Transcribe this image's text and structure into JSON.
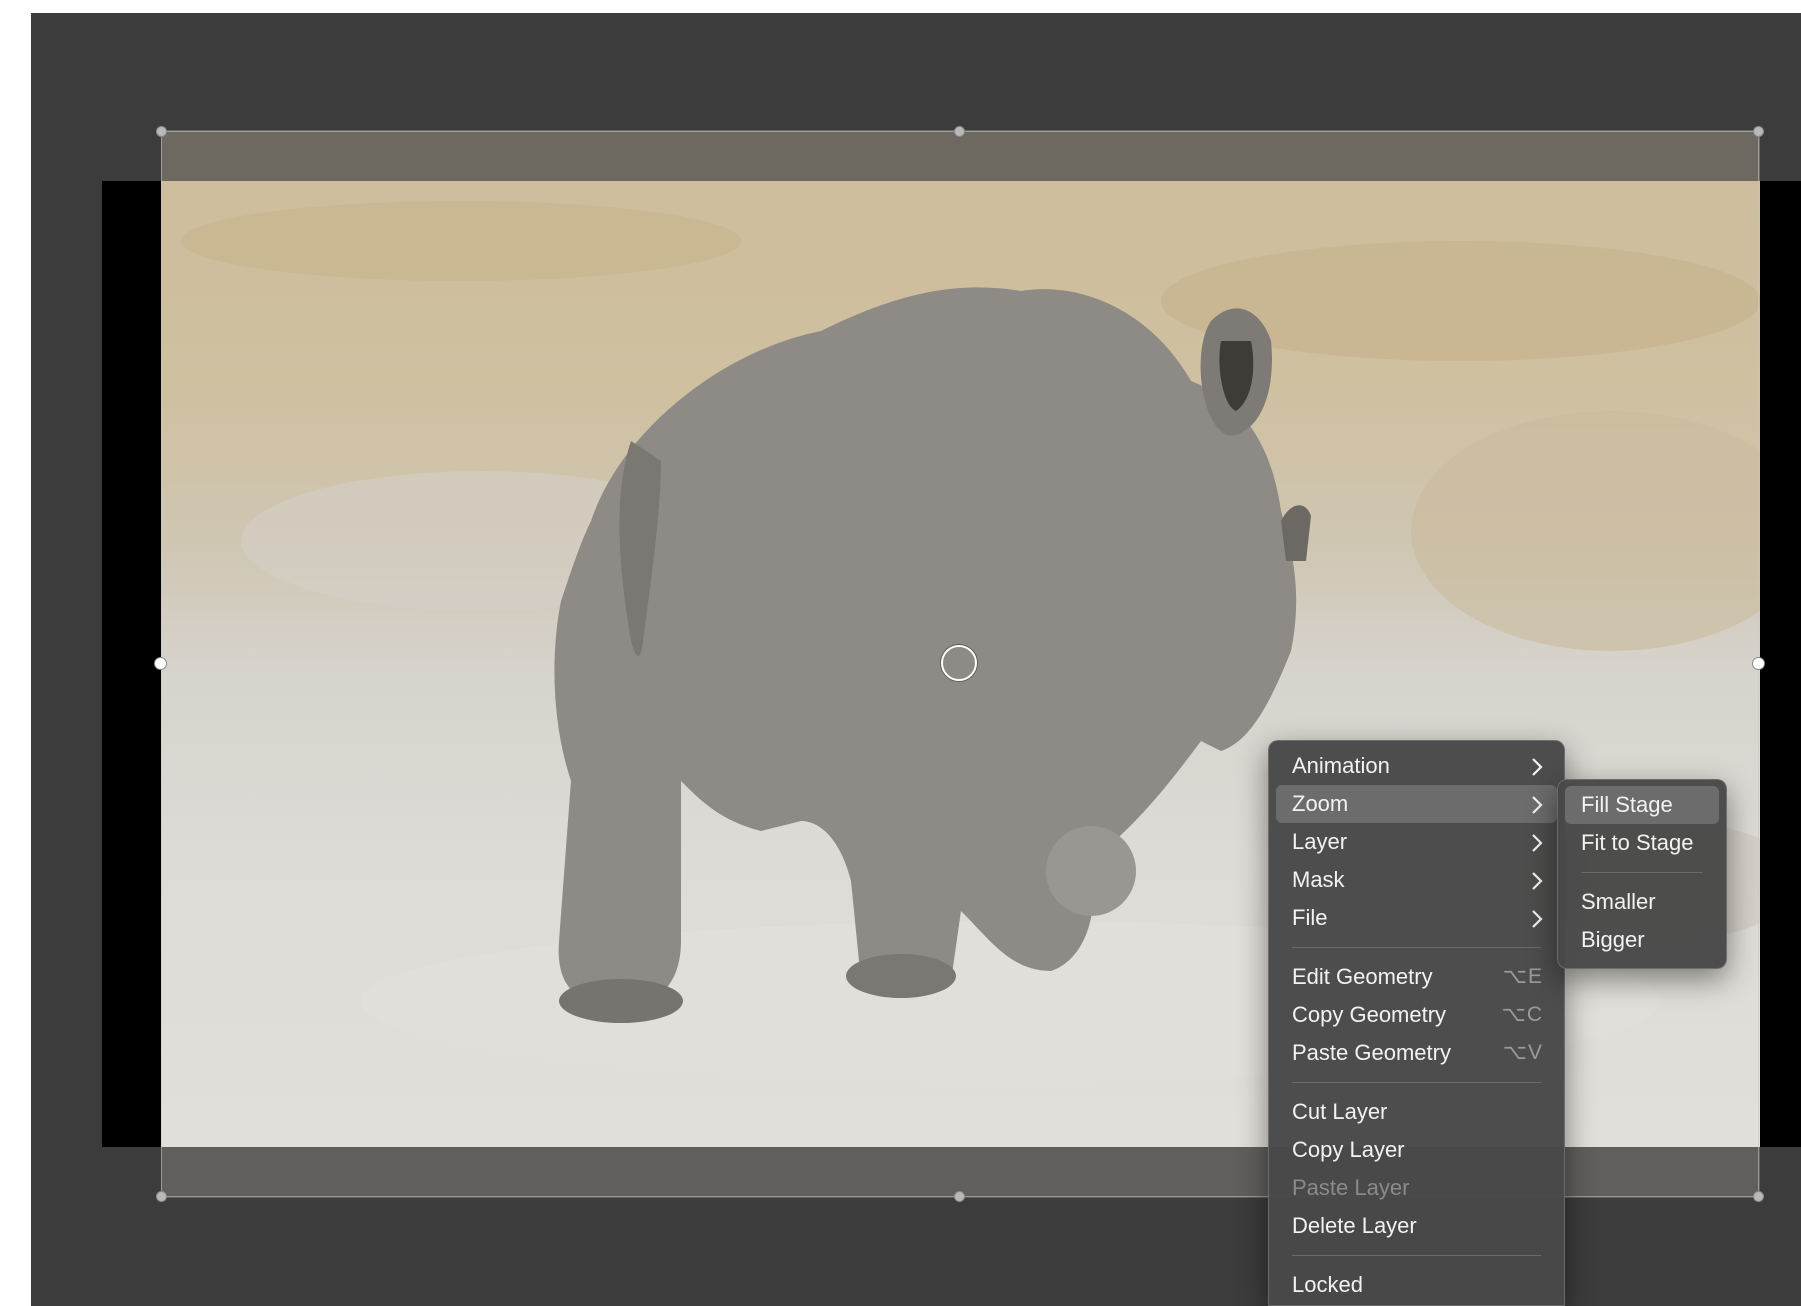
{
  "context_menu": {
    "items": [
      {
        "label": "Animation",
        "submenu": true
      },
      {
        "label": "Zoom",
        "submenu": true,
        "selected": true
      },
      {
        "label": "Layer",
        "submenu": true
      },
      {
        "label": "Mask",
        "submenu": true
      },
      {
        "label": "File",
        "submenu": true
      },
      {
        "label": "Edit Geometry",
        "shortcut": "⌥E"
      },
      {
        "label": "Copy Geometry",
        "shortcut": "⌥C"
      },
      {
        "label": "Paste Geometry",
        "shortcut": "⌥V"
      },
      {
        "label": "Cut Layer"
      },
      {
        "label": "Copy Layer"
      },
      {
        "label": "Paste Layer",
        "disabled": true
      },
      {
        "label": "Delete Layer"
      },
      {
        "label": "Locked"
      }
    ]
  },
  "zoom_submenu": {
    "items": [
      {
        "label": "Fill Stage",
        "selected": true
      },
      {
        "label": "Fit to Stage"
      },
      {
        "label": "Smaller"
      },
      {
        "label": "Bigger"
      }
    ]
  },
  "icons": {
    "submenu_arrow": "chevron-right-icon",
    "center_marker": "circle-icon"
  },
  "colors": {
    "workspace": "#3c3c3c",
    "menu_bg": "#484848",
    "selected_bg": "#6c6c6c"
  }
}
